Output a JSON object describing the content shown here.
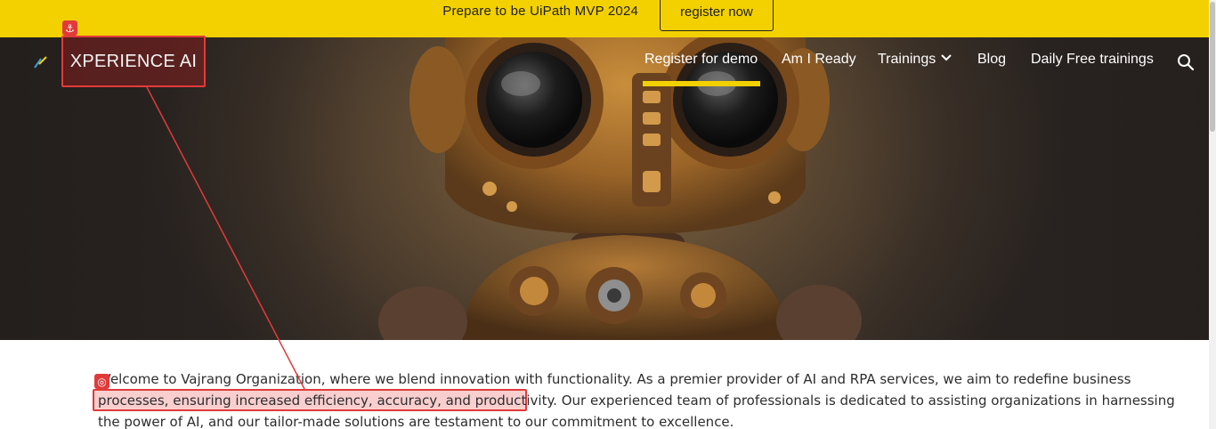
{
  "announcement": {
    "text": "Prepare to be UiPath MVP 2024",
    "button_label": "register now"
  },
  "brand": {
    "name": "XPERIENCE AI"
  },
  "nav": {
    "items": [
      {
        "label": "Register for demo"
      },
      {
        "label": "Am I Ready"
      },
      {
        "label": "Trainings"
      },
      {
        "label": "Blog"
      },
      {
        "label": "Daily Free trainings"
      }
    ]
  },
  "intro": {
    "line1": "Welcome to Vajrang Organization, where we blend innovation with functionality. As a premier provider of AI and RPA services, we aim to redefine business",
    "line2_highlight": "processes, ensuring increased efficiency, accuracy, and productivity.",
    "line2_rest": " Our experienced team of professionals is dedicated to assisting organizations in harnessing",
    "line3": "the power of AI, and our tailor-made solutions are testament to our commitment to excellence."
  },
  "annotations": {
    "anchor_icon": "anchor-icon",
    "target_icon": "target-icon"
  },
  "colors": {
    "accent": "#f3d100",
    "annotation": "#e23a3a"
  }
}
